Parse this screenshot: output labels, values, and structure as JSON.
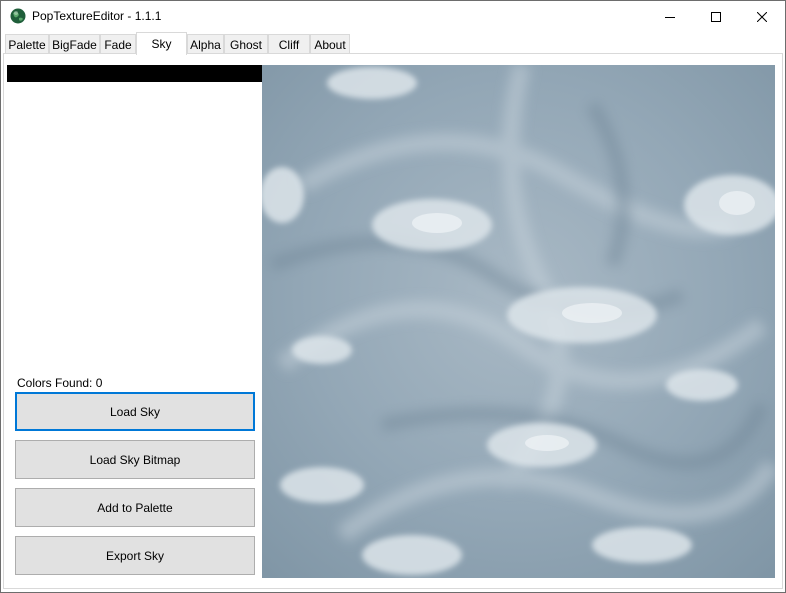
{
  "window": {
    "title": "PopTextureEditor - 1.1.1",
    "app_icon": "globe-icon",
    "controls": [
      "minimize-icon",
      "maximize-icon",
      "close-icon"
    ]
  },
  "tabs": [
    {
      "label": "Palette",
      "active": false
    },
    {
      "label": "BigFade",
      "active": false
    },
    {
      "label": "Fade",
      "active": false
    },
    {
      "label": "Sky",
      "active": true
    },
    {
      "label": "Alpha",
      "active": false
    },
    {
      "label": "Ghost",
      "active": false
    },
    {
      "label": "Cliff",
      "active": false
    },
    {
      "label": "About",
      "active": false
    }
  ],
  "sky_tab": {
    "colors_found_label": "Colors Found:",
    "colors_found_value": "0",
    "buttons": {
      "load_sky": "Load Sky",
      "load_sky_bitmap": "Load Sky Bitmap",
      "add_to_palette": "Add to Palette",
      "export_sky": "Export Sky"
    },
    "focused_button": "Load Sky"
  },
  "colors": {
    "focus_border": "#0078d7",
    "button_face": "#e1e1e1",
    "palette_strip": "#000000",
    "sky_base": "#8ea2b1",
    "sky_cloud": "#dfe6eb"
  }
}
